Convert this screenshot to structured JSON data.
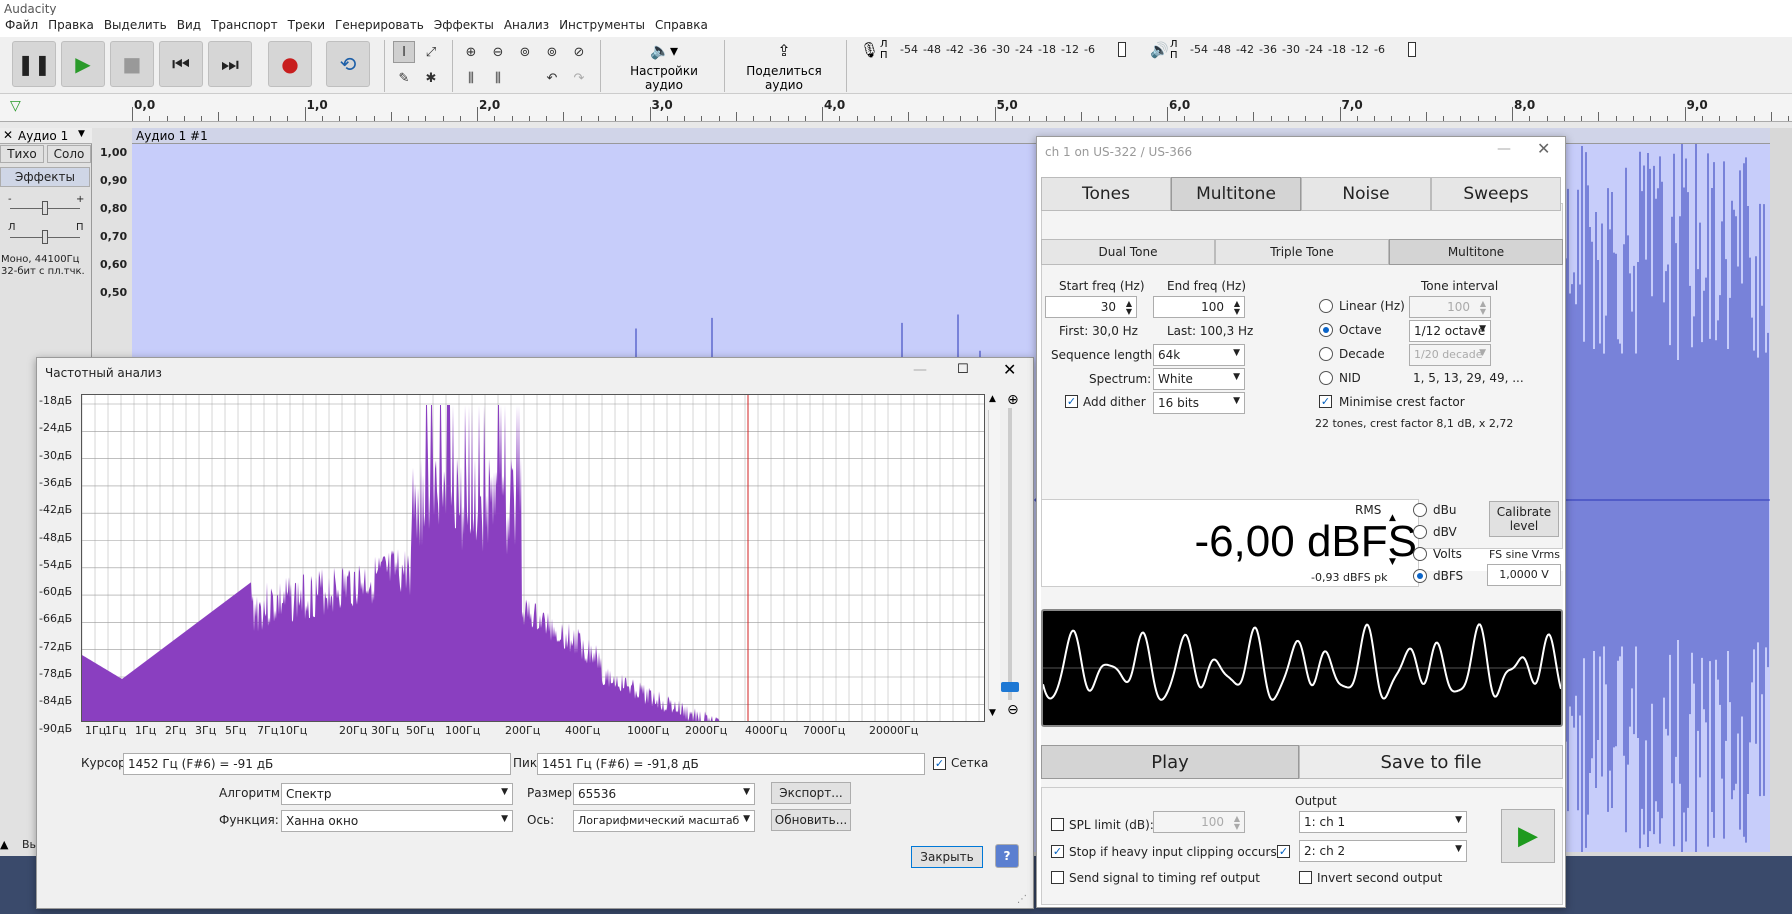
{
  "app": {
    "title": "Audacity"
  },
  "menu": [
    "Файл",
    "Правка",
    "Выделить",
    "Вид",
    "Транспорт",
    "Треки",
    "Генерировать",
    "Эффекты",
    "Анализ",
    "Инструменты",
    "Справка"
  ],
  "toolbar": {
    "audio_setup": "Настройки аудио",
    "share_audio": "Поделиться аудио",
    "meter_ticks": [
      "-54",
      "-48",
      "-42",
      "-36",
      "-30",
      "-24",
      "-18",
      "-12",
      "-6"
    ],
    "rec_meter_label": "Л\nП",
    "play_meter_label": "Л\nП"
  },
  "ruler": {
    "ticks": [
      "0,0",
      "1,0",
      "2,0",
      "3,0",
      "4,0",
      "5,0",
      "6,0",
      "7,0",
      "8,0",
      "9,0"
    ]
  },
  "track": {
    "name": "Аудио 1",
    "mute": "Тихо",
    "solo": "Соло",
    "effects": "Эффекты",
    "info1": "Моно, 44100Гц",
    "info2": "32-бит с пл.тчк.",
    "clip_name": "Аудио 1 #1",
    "yticks": [
      "1,00",
      "0,90",
      "0,80",
      "0,70",
      "0,60",
      "0,50"
    ],
    "pan_left": "Л",
    "pan_right": "П",
    "gain_minus": "-",
    "gain_plus": "+",
    "select_label": "Вы"
  },
  "freq": {
    "title": "Частотный анализ",
    "db_ticks": [
      "-18дБ",
      "-24дБ",
      "-30дБ",
      "-36дБ",
      "-42дБ",
      "-48дБ",
      "-54дБ",
      "-60дБ",
      "-66дБ",
      "-72дБ",
      "-78дБ",
      "-84дБ",
      "-90дБ"
    ],
    "hz_ticks": [
      "1Гц",
      "1Гц",
      "1Гц",
      "2Гц",
      "3Гц",
      "5Гц",
      "7Гц",
      "10Гц",
      "20Гц",
      "30Гц",
      "50Гц",
      "100Гц",
      "200Гц",
      "400Гц",
      "1000Гц",
      "2000Гц",
      "4000Гц",
      "7000Гц",
      "20000Гц"
    ],
    "cursor_label": "Курсор:",
    "cursor_value": "1452 Гц (F#6) = -91 дБ",
    "peak_label": "Пик:",
    "peak_value": "1451 Гц (F#6) = -91,8 дБ",
    "grid_label": "Сетка",
    "algorithm_label": "Алгоритм:",
    "algorithm_value": "Спектр",
    "function_label": "Функция:",
    "function_value": "Ханна  окно",
    "size_label": "Размер:",
    "size_value": "65536",
    "axis_label": "Ось:",
    "axis_value": "Логарифмический масштаб",
    "export": "Экспорт...",
    "refresh": "Обновить...",
    "close": "Закрыть",
    "help": "?"
  },
  "rew": {
    "title": "ch 1 on US-322 / US-366",
    "tabs": [
      "Tones",
      "Multitone",
      "Noise",
      "Sweeps"
    ],
    "subtabs": [
      "Dual Tone",
      "Triple Tone",
      "Multitone"
    ],
    "start_freq_label": "Start freq (Hz)",
    "start_freq": "30",
    "end_freq_label": "End freq (Hz)",
    "end_freq": "100",
    "first": "First: 30,0 Hz",
    "last": "Last: 100,3 Hz",
    "seq_len_label": "Sequence length:",
    "seq_len": "64k",
    "spectrum_label": "Spectrum:",
    "spectrum": "White",
    "add_dither": "Add dither",
    "bits": "16 bits",
    "tone_interval_label": "Tone interval",
    "linear": "Linear (Hz)",
    "linear_val": "100",
    "octave": "Octave",
    "octave_val": "1/12 octave",
    "decade": "Decade",
    "decade_val": "1/20 decade",
    "nid": "NID",
    "nid_val": "1, 5, 13, 29, 49, ...",
    "minimise": "Minimise crest factor",
    "tones_info": "22 tones, crest factor 8,1 dB, x 2,72",
    "rms": "RMS",
    "level": "-6,00 dBFS",
    "pk": "-0,93 dBFS pk",
    "units": [
      "dBu",
      "dBV",
      "Volts",
      "dBFS"
    ],
    "calibrate": "Calibrate level",
    "fs_sine_label": "FS sine Vrms",
    "fs_sine": "1,0000 V",
    "play": "Play",
    "save": "Save to file",
    "spl_limit": "SPL limit (dB):",
    "spl_val": "100",
    "stop_clip": "Stop if heavy input clipping occurs",
    "timing_ref": "Send signal to timing ref output",
    "output_label": "Output",
    "out1": "1: ch 1",
    "out2": "2: ch 2",
    "invert": "Invert second output"
  },
  "colors": {
    "spectrum": "#8a3fc0",
    "wave": "#2a36b8",
    "wavebg": "#c7cdfa"
  }
}
